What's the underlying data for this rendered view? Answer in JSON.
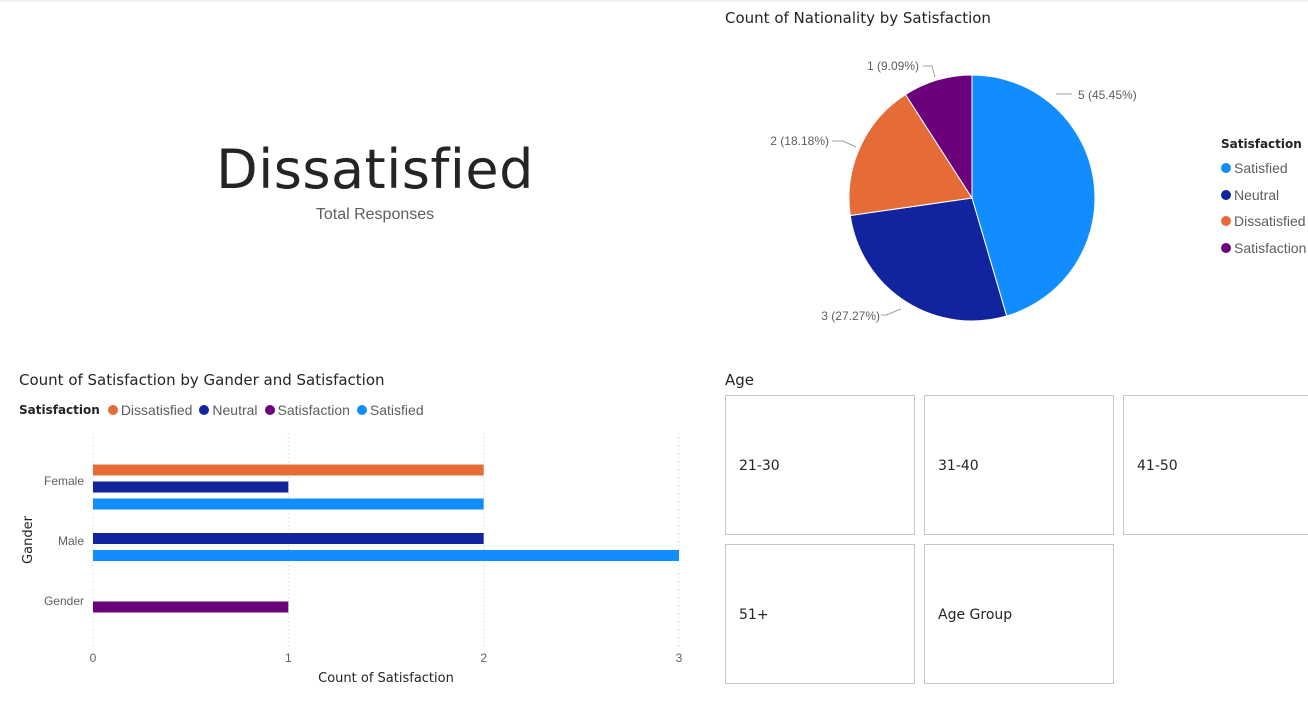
{
  "kpi": {
    "value": "Dissatisfied",
    "label": "Total Responses"
  },
  "colors": {
    "Satisfied": "#118dff",
    "Neutral": "#12239e",
    "Dissatisfied": "#e66c37",
    "Satisfaction": "#6b007b"
  },
  "pie": {
    "title": "Count of Nationality by Satisfaction",
    "legend_title": "Satisfaction",
    "legend": [
      "Satisfied",
      "Neutral",
      "Dissatisfied",
      "Satisfaction"
    ]
  },
  "bar": {
    "title": "Count of Satisfaction by Gander and Satisfaction",
    "legend_title": "Satisfaction",
    "legend": [
      "Dissatisfied",
      "Neutral",
      "Satisfaction",
      "Satisfied"
    ]
  },
  "age": {
    "title": "Age",
    "tiles": [
      "21-30",
      "31-40",
      "41-50",
      "51+",
      "Age Group"
    ]
  },
  "chart_data": [
    {
      "type": "pie",
      "title": "Count of Nationality by Satisfaction",
      "legend_title": "Satisfaction",
      "legend_position": "right",
      "slices": [
        {
          "label": "Satisfied",
          "value": 5,
          "data_label": "5 (45.45%)"
        },
        {
          "label": "Neutral",
          "value": 3,
          "data_label": "3 (27.27%)"
        },
        {
          "label": "Dissatisfied",
          "value": 2,
          "data_label": "2 (18.18%)"
        },
        {
          "label": "Satisfaction",
          "value": 1,
          "data_label": "1 (9.09%)"
        }
      ]
    },
    {
      "type": "bar",
      "orientation": "horizontal",
      "title": "Count of Satisfaction by Gander and Satisfaction",
      "xlabel": "Count of Satisfaction",
      "ylabel": "Gander",
      "xlim": [
        0,
        3
      ],
      "xticks": [
        "0",
        "1",
        "2",
        "3"
      ],
      "grid": true,
      "legend_title": "Satisfaction",
      "legend_position": "top-left",
      "categories": [
        "Female",
        "Male",
        "Gender"
      ],
      "series": [
        {
          "name": "Dissatisfied",
          "values": [
            2,
            null,
            null
          ]
        },
        {
          "name": "Neutral",
          "values": [
            1,
            2,
            null
          ]
        },
        {
          "name": "Satisfaction",
          "values": [
            null,
            null,
            1
          ]
        },
        {
          "name": "Satisfied",
          "values": [
            2,
            3,
            null
          ]
        }
      ]
    }
  ]
}
